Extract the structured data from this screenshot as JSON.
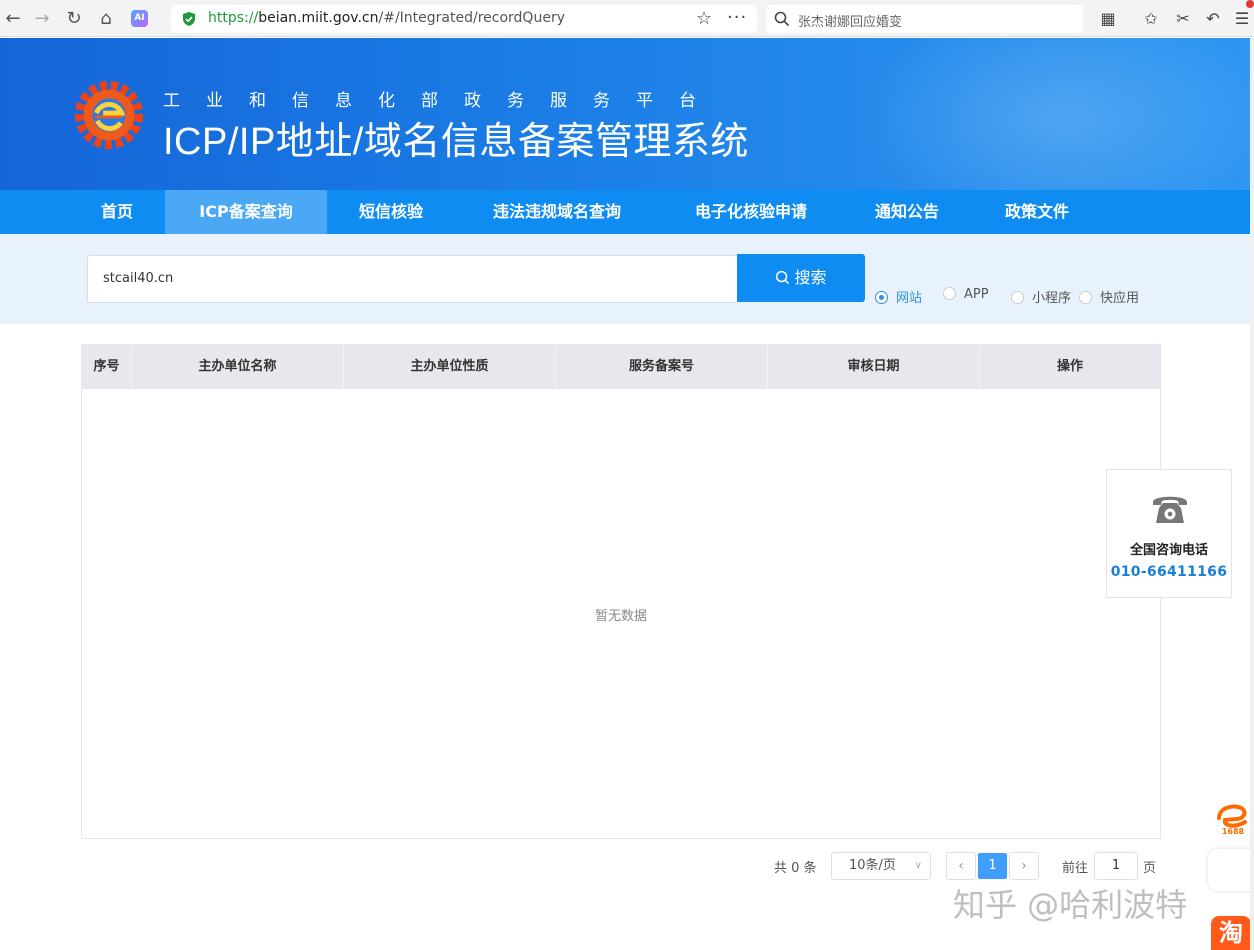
{
  "browser": {
    "url_scheme": "https://",
    "url_host": "beian.miit.gov.cn",
    "url_path": "/#/Integrated/recordQuery",
    "ai_badge": "AI",
    "search_text": "张杰谢娜回应婚变"
  },
  "header": {
    "subtitle": "工业和信息化部政务服务平台",
    "title": "ICP/IP地址/域名信息备案管理系统"
  },
  "nav": {
    "items": [
      "首页",
      "ICP备案查询",
      "短信核验",
      "违法违规域名查询",
      "电子化核验申请",
      "通知公告",
      "政策文件"
    ],
    "active_index": 1
  },
  "search": {
    "value": "stcail40.cn",
    "button_label": "搜索",
    "types": [
      "网站",
      "APP",
      "小程序",
      "快应用"
    ],
    "selected_type": "网站"
  },
  "table": {
    "columns": [
      "序号",
      "主办单位名称",
      "主办单位性质",
      "服务备案号",
      "审核日期",
      "操作"
    ],
    "rows": [],
    "empty_text": "暂无数据"
  },
  "contact": {
    "label": "全国咨询电话",
    "phone": "010-66411166"
  },
  "pagination": {
    "total_text": "共 0 条",
    "page_size": "10条/页",
    "current_page": "1",
    "goto_label": "前往",
    "goto_value": "1",
    "page_suffix": "页"
  },
  "watermark": "知乎 @哈利波特",
  "side_badges": {
    "alibaba": "1688",
    "taobao": "淘"
  },
  "colors": {
    "brand_blue": "#0e8cf1",
    "active_nav": "#4aa8f5",
    "link_blue": "#1a7ed6"
  }
}
